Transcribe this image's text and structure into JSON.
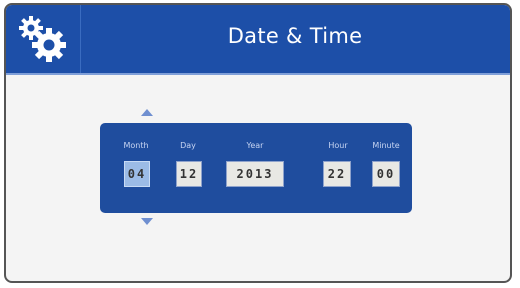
{
  "header": {
    "title": "Date & Time",
    "settings_icon": "gear-icon"
  },
  "picker": {
    "month": {
      "label": "Month",
      "value": "04",
      "selected": true
    },
    "day": {
      "label": "Day",
      "value": "12"
    },
    "year": {
      "label": "Year",
      "value": "2013"
    },
    "hour": {
      "label": "Hour",
      "value": "22"
    },
    "minute": {
      "label": "Minute",
      "value": "00"
    },
    "increment_icon": "triangle-up-icon",
    "decrement_icon": "triangle-down-icon"
  },
  "colors": {
    "header_bg": "#1d4fa8",
    "panel_bg": "#1f4d9e",
    "selected_field": "#9bbbe6",
    "field_bg": "#e8e8e4"
  }
}
